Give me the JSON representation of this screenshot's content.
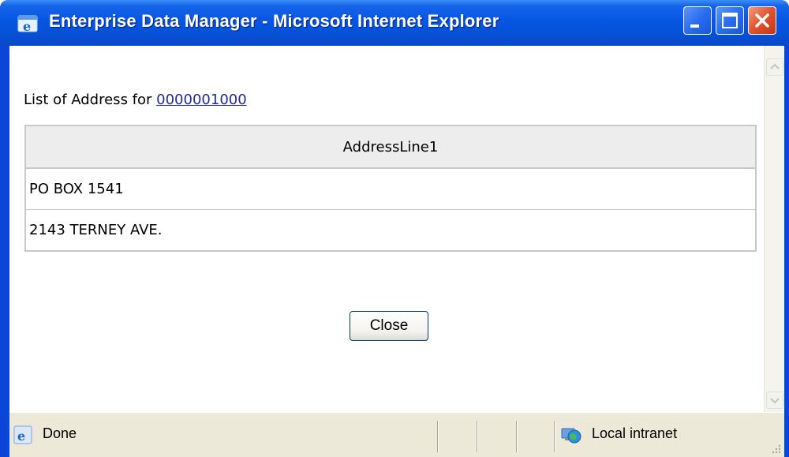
{
  "window": {
    "title": "Enterprise Data Manager - Microsoft Internet Explorer",
    "controls": [
      "minimize",
      "maximize",
      "close"
    ]
  },
  "page": {
    "heading_prefix": "List of Address for",
    "heading_link": "0000001000",
    "table": {
      "columns": [
        "AddressLine1"
      ],
      "rows": [
        [
          "PO BOX 1541"
        ],
        [
          "2143 TERNEY AVE."
        ]
      ]
    },
    "close_button": "Close"
  },
  "statusbar": {
    "status": "Done",
    "zone": "Local intranet",
    "icons": [
      "ie-page-icon",
      "local-intranet-icon"
    ]
  },
  "colors": {
    "titlebar": "#0552d8",
    "link": "#1f2b99",
    "table_header_bg": "#ededed",
    "statusbar_bg": "#ece9d8"
  }
}
